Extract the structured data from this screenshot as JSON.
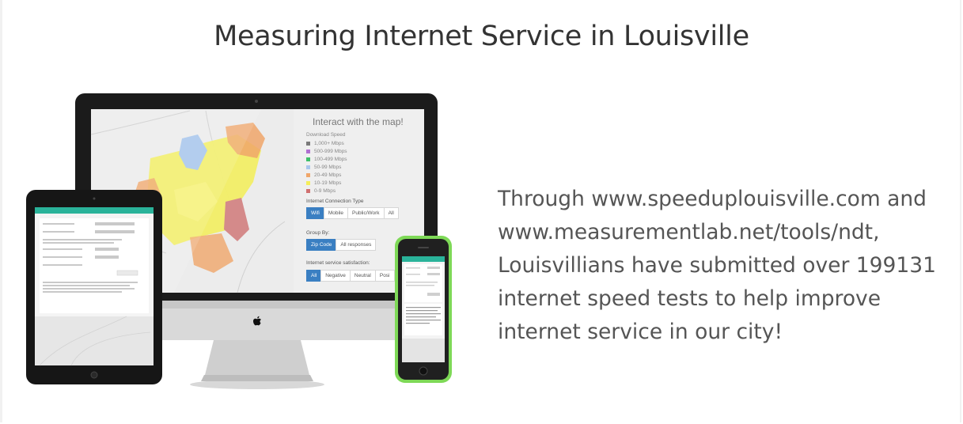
{
  "header": {
    "title": "Measuring Internet Service in Louisville"
  },
  "map_panel": {
    "heading": "Interact with the map!",
    "legend_title": "Download Speed",
    "legend": [
      {
        "label": "1,000+ Mbps",
        "color": "#7a7a7a"
      },
      {
        "label": "500-999 Mbps",
        "color": "#b06fd1"
      },
      {
        "label": "100-499 Mbps",
        "color": "#3dbf6a"
      },
      {
        "label": "50-99 Mbps",
        "color": "#a9c6ec"
      },
      {
        "label": "20-49 Mbps",
        "color": "#f0a66a"
      },
      {
        "label": "10-19 Mbps",
        "color": "#f5ee5a"
      },
      {
        "label": "0-9 Mbps",
        "color": "#d07070"
      }
    ],
    "connection_label": "Internet Connection Type",
    "connection_buttons": [
      "Wifi",
      "Mobile",
      "Public/Work",
      "All"
    ],
    "group_label": "Group By:",
    "group_buttons": [
      "Zip Code",
      "All responses"
    ],
    "satisfaction_label": "Internet service satisfaction:",
    "satisfaction_buttons": [
      "All",
      "Negative",
      "Neutral",
      "Posi"
    ]
  },
  "body": {
    "tagline": "Through www.speeduplouisville.com and www.measurementlab.net/tools/ndt, Louisvillians have submitted over 199131 internet speed tests to help improve internet service in our city!"
  },
  "colors": {
    "text": "#555555",
    "title": "#333333",
    "accent": "#3a7fc2",
    "device_green": "#7ed957",
    "tablet_header": "#2ab39a"
  }
}
